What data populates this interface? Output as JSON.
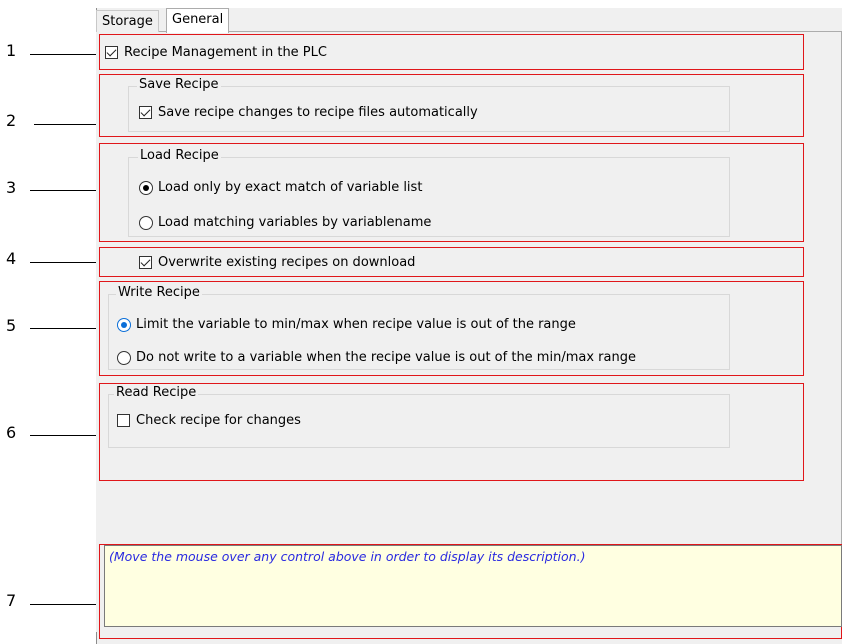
{
  "tabs": [
    {
      "label": "Storage",
      "active": false
    },
    {
      "label": "General",
      "active": true
    }
  ],
  "callouts": [
    "1",
    "2",
    "3",
    "4",
    "5",
    "6",
    "7"
  ],
  "recipe_management": {
    "label": "Recipe Management in the PLC",
    "checked": true
  },
  "save_recipe": {
    "title": "Save Recipe",
    "auto_save": {
      "label": "Save recipe changes to recipe files automatically",
      "checked": true
    }
  },
  "load_recipe": {
    "title": "Load Recipe",
    "options": [
      {
        "label": "Load only by exact match of variable list",
        "selected": true
      },
      {
        "label": "Load matching variables by variablename",
        "selected": false
      }
    ]
  },
  "overwrite": {
    "label": "Overwrite existing recipes on download",
    "checked": true
  },
  "write_recipe": {
    "title": "Write Recipe",
    "options": [
      {
        "label": "Limit the variable to min/max when recipe value is out of the range",
        "selected": true
      },
      {
        "label": "Do not write to a variable when the recipe value is out of the min/max range",
        "selected": false
      }
    ]
  },
  "read_recipe": {
    "title": "Read Recipe",
    "check_changes": {
      "label": "Check recipe for changes",
      "checked": false
    }
  },
  "description": {
    "text": "(Move the mouse over any control above in order to display its description.)"
  },
  "colors": {
    "highlight_border": "#e0161a",
    "description_bg": "#ffffe1",
    "description_text": "#2a2ae0",
    "radio_accent": "#0a6ed8"
  }
}
